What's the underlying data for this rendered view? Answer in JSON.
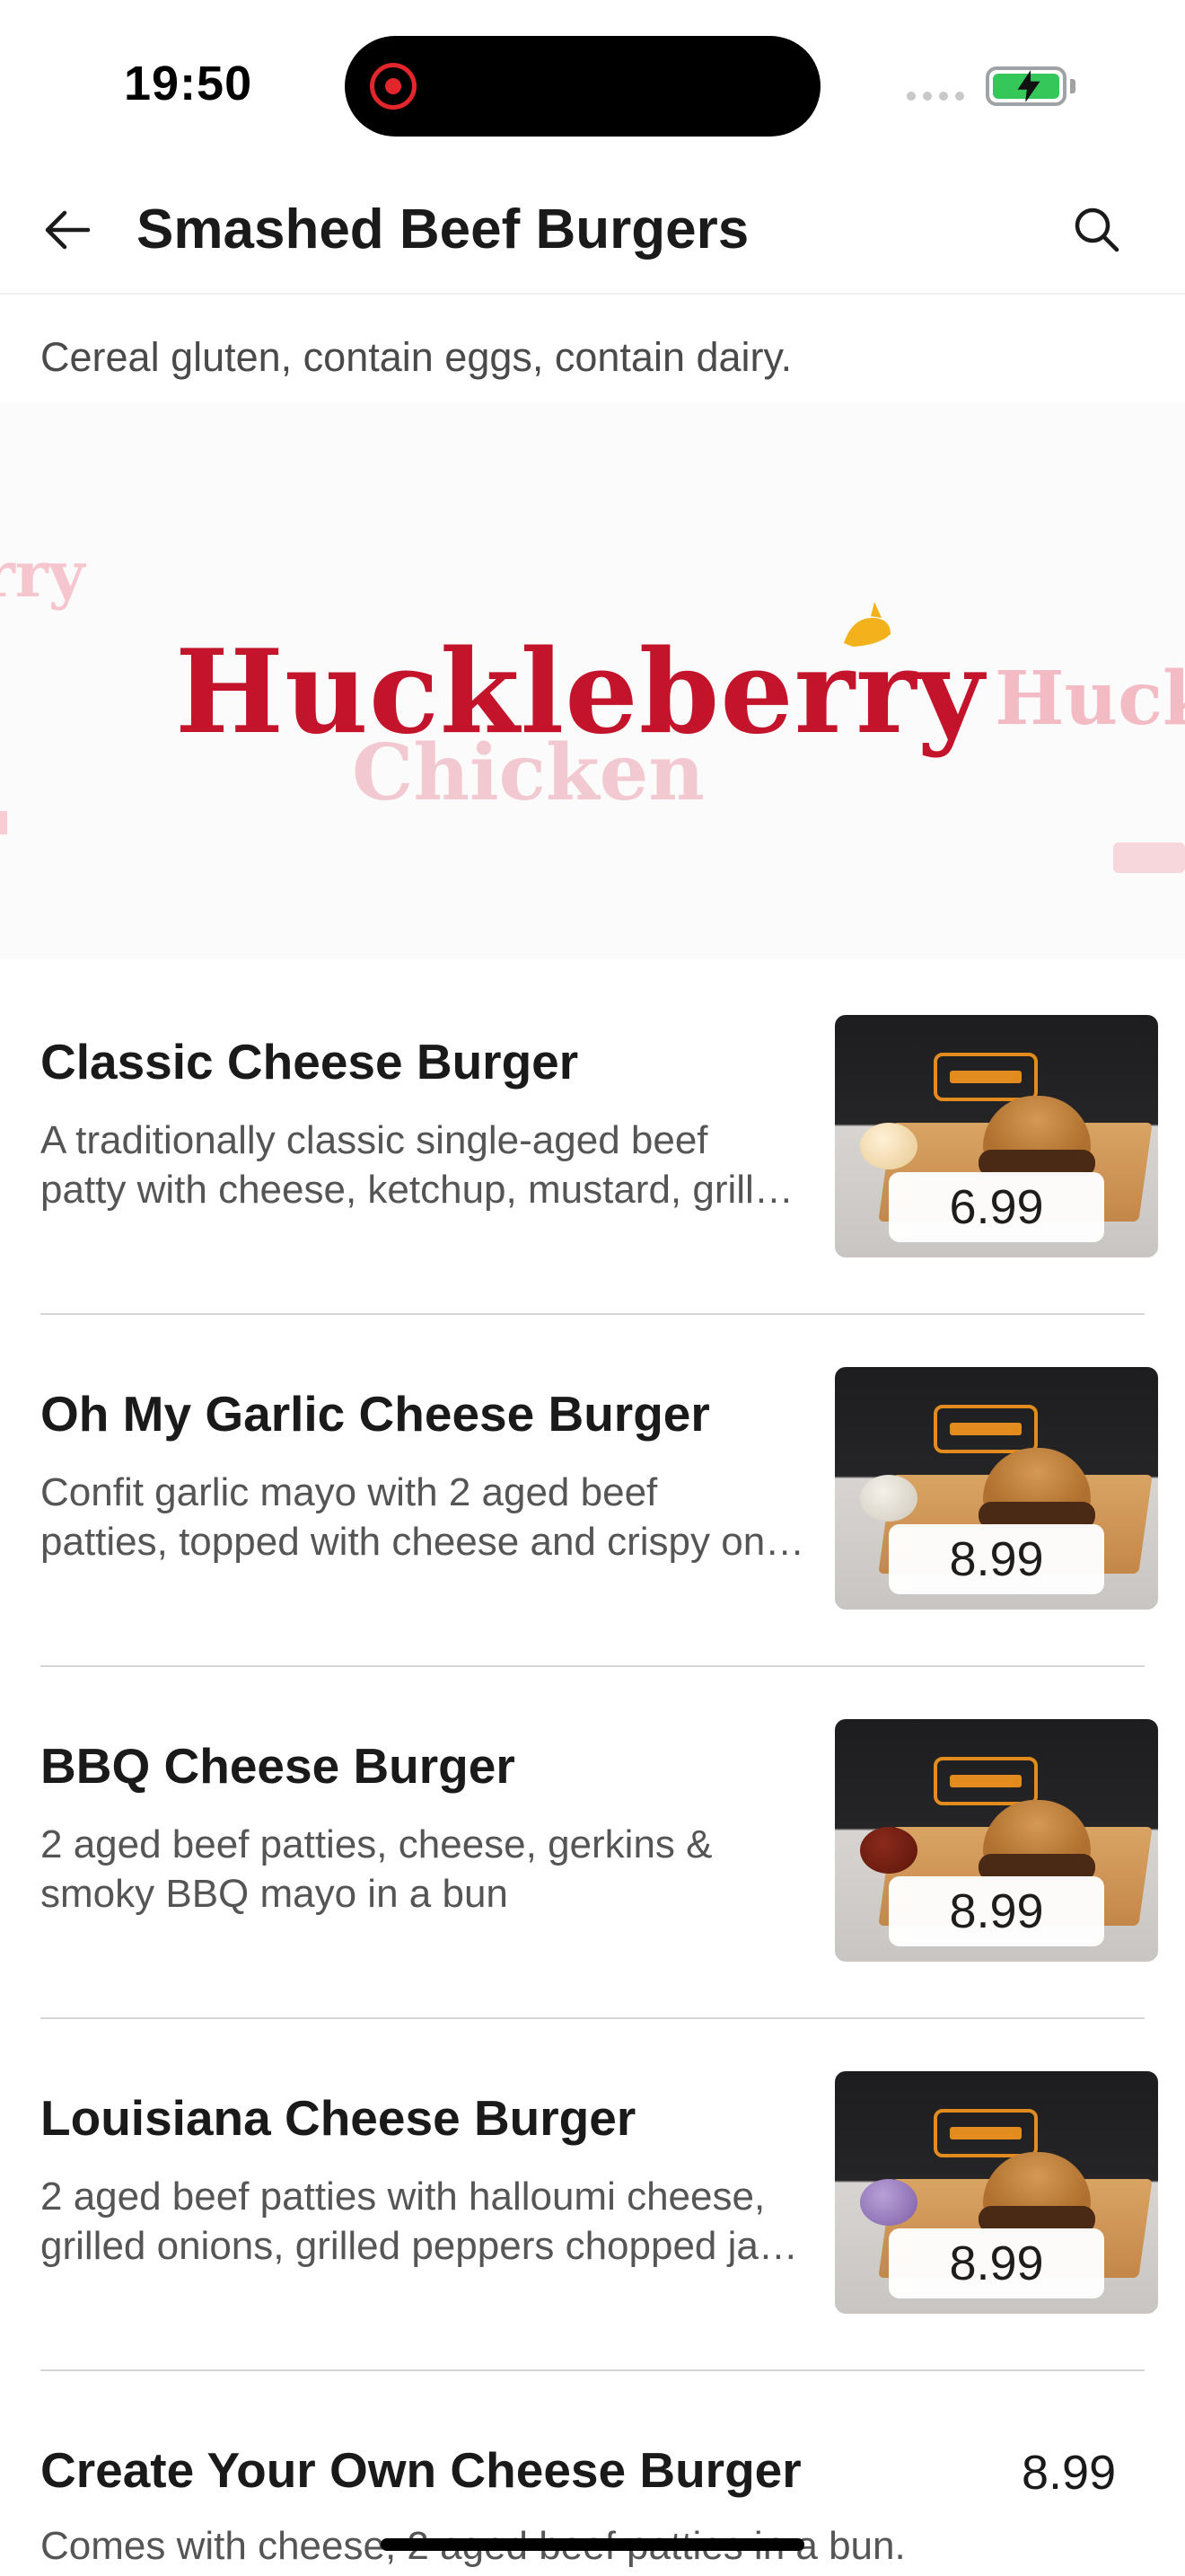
{
  "status_bar": {
    "time": "19:50"
  },
  "header": {
    "title": "Smashed Beef Burgers",
    "back_icon": "arrow-left-icon",
    "search_icon": "search-icon"
  },
  "allergens": "Cereal gluten, contain eggs, contain dairy.",
  "banner": {
    "brand_main": "Huckleberry",
    "brand_sub": "Chicken",
    "ghost_left": "rry",
    "ghost_right": "Huck"
  },
  "menu": {
    "items": [
      {
        "name": "Classic Cheese Burger",
        "desc_line1": "A traditionally classic single-aged beef",
        "desc_line2": "patty with cheese, ketchup, mustard, grill…",
        "price": "6.99"
      },
      {
        "name": "Oh My Garlic Cheese Burger",
        "desc_line1": "Confit garlic mayo with 2 aged beef",
        "desc_line2": "patties, topped with cheese and crispy on…",
        "price": "8.99"
      },
      {
        "name": "BBQ Cheese Burger",
        "desc_line1": "2 aged beef patties, cheese, gerkins &",
        "desc_line2": "smoky BBQ mayo in a bun",
        "price": "8.99"
      },
      {
        "name": "Louisiana Cheese Burger",
        "desc_line1": "2 aged beef patties with halloumi cheese,",
        "desc_line2": "grilled onions, grilled peppers chopped ja…",
        "price": "8.99"
      }
    ],
    "last_item": {
      "name": "Create Your Own Cheese Burger",
      "price": "8.99",
      "desc_line1": "Comes with cheese, 2 aged beef patties in a bun."
    }
  },
  "colors": {
    "brand_red": "#c4142b",
    "battery_green": "#35c759",
    "recording_red": "#e3262b"
  }
}
